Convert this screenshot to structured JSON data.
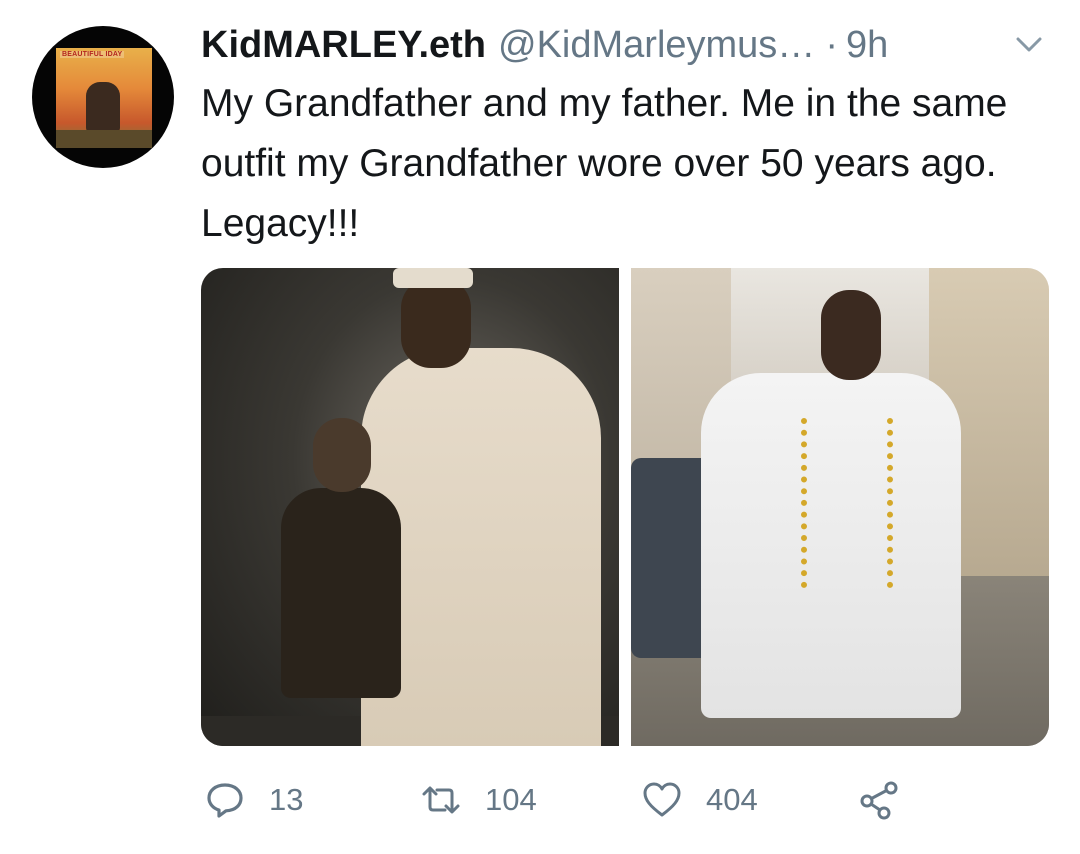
{
  "user": {
    "display_name": "KidMARLEY.eth",
    "handle": "@KidMarleymus…",
    "time_separator": "·",
    "timestamp": "9h"
  },
  "avatar": {
    "art_text": "BEAUTIFUL IDAY"
  },
  "tweet": {
    "text": "My Grandfather and my father. Me in the same outfit my Grandfather wore over 50 years ago. Legacy!!!"
  },
  "media": {
    "count": 2
  },
  "actions": {
    "replies": "13",
    "retweets": "104",
    "likes": "404"
  },
  "icons": {
    "reply": "reply-icon",
    "retweet": "retweet-icon",
    "like": "heart-icon",
    "share": "share-icon",
    "caret": "chevron-down-icon"
  },
  "colors": {
    "text_primary": "#14171a",
    "text_secondary": "#657786"
  }
}
